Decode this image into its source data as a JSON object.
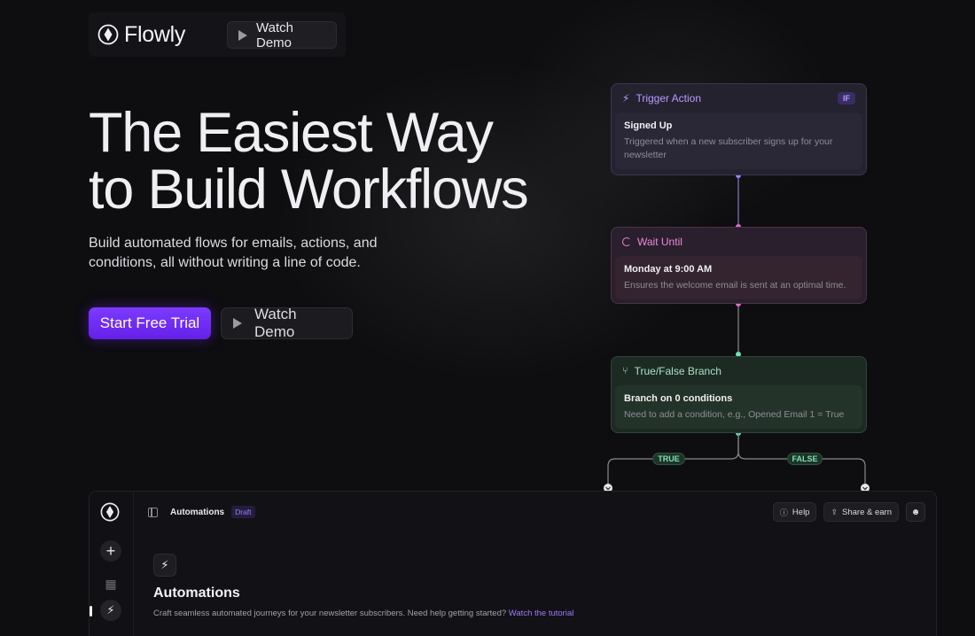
{
  "nav": {
    "brand": "Flowly",
    "watch_demo": "Watch Demo"
  },
  "hero": {
    "title_line1": "The Easiest Way",
    "title_line2": "to Build Workflows",
    "subtitle": "Build automated flows for emails, actions, and conditions, all without writing a line of code.",
    "cta_primary": "Start Free Trial",
    "cta_secondary": "Watch Demo"
  },
  "flow": {
    "trigger": {
      "header": "Trigger Action",
      "badge": "IF",
      "title": "Signed Up",
      "description": "Triggered when a new subscriber signs up for your newsletter"
    },
    "wait": {
      "header": "Wait Until",
      "title": "Monday at 9:00 AM",
      "description": "Ensures the welcome email is sent at an optimal time."
    },
    "branch": {
      "header": "True/False Branch",
      "title": "Branch on 0 conditions",
      "description": "Need to add a condition, e.g., Opened Email 1 = True"
    },
    "true_label": "TRUE",
    "false_label": "FALSE"
  },
  "app": {
    "breadcrumb": "Automations",
    "status": "Draft",
    "help": "Help",
    "share": "Share & earn",
    "page_title": "Automations",
    "page_description": "Craft seamless automated journeys for your newsletter subscribers. Need help getting started? ",
    "tutorial_link": "Watch the tutorial"
  },
  "colors": {
    "accent": "#6b2cf5",
    "trigger": "#b79bff",
    "wait": "#e98ad8",
    "branch": "#7ee0b0"
  }
}
